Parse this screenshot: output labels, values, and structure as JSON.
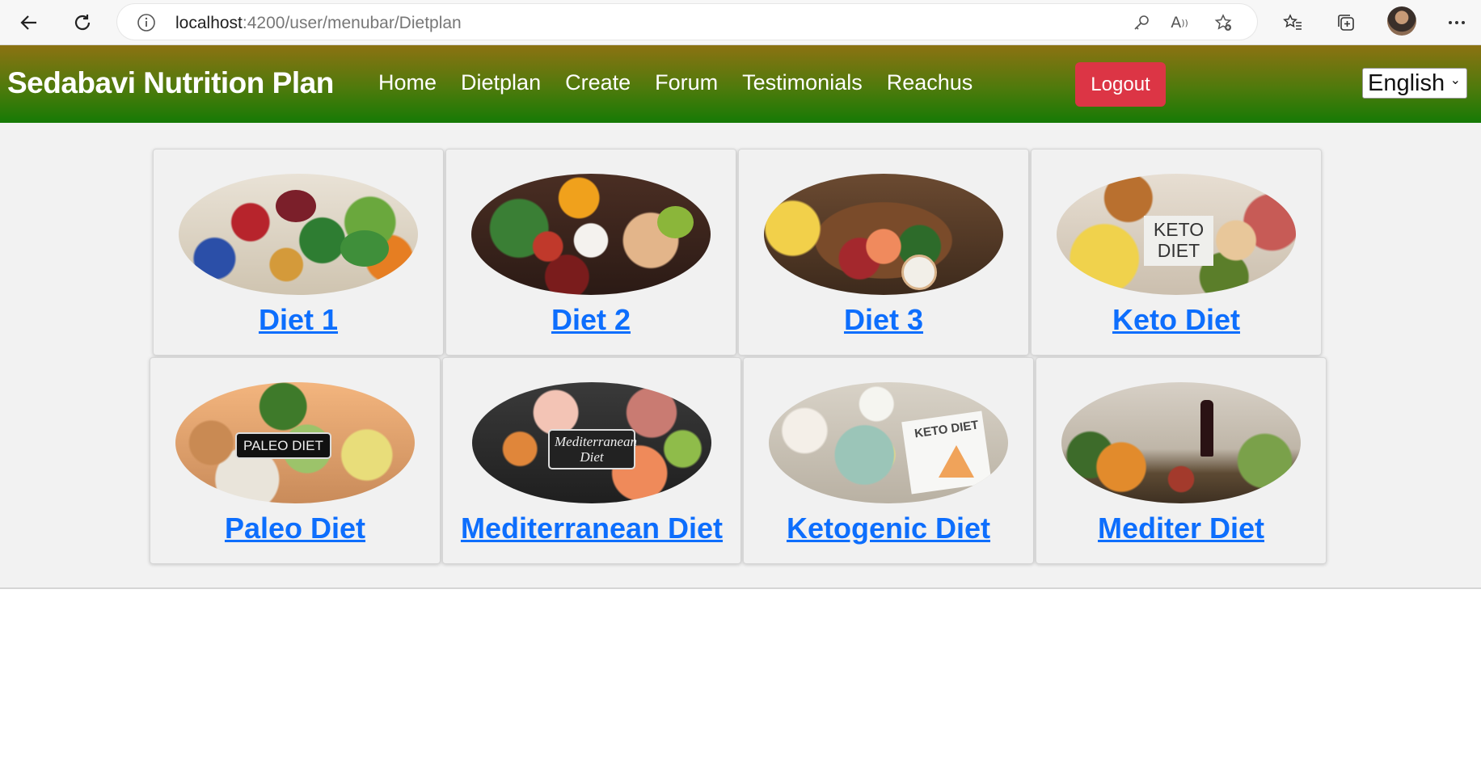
{
  "browser": {
    "url_host": "localhost",
    "url_path": ":4200/user/menubar/Dietplan"
  },
  "navbar": {
    "brand": "Sedabavi Nutrition Plan",
    "menu": [
      "Home",
      "Dietplan",
      "Create",
      "Forum",
      "Testimonials",
      "Reachus"
    ],
    "logout_label": "Logout",
    "language": "English"
  },
  "cards": [
    {
      "title": "Diet 1"
    },
    {
      "title": "Diet 2"
    },
    {
      "title": "Diet 3"
    },
    {
      "title": "Keto Diet"
    },
    {
      "title": "Paleo Diet",
      "image_text": "PALEO DIET"
    },
    {
      "title": "Mediterranean Diet",
      "image_text": "Mediterranean Diet"
    },
    {
      "title": "Ketogenic Diet",
      "image_text": "KETO DIET"
    },
    {
      "title": "Mediter Diet"
    }
  ],
  "colors": {
    "navbar_top": "#8c7212",
    "navbar_bottom": "#167a05",
    "logout": "#dc3545",
    "link": "#0d6efd"
  }
}
